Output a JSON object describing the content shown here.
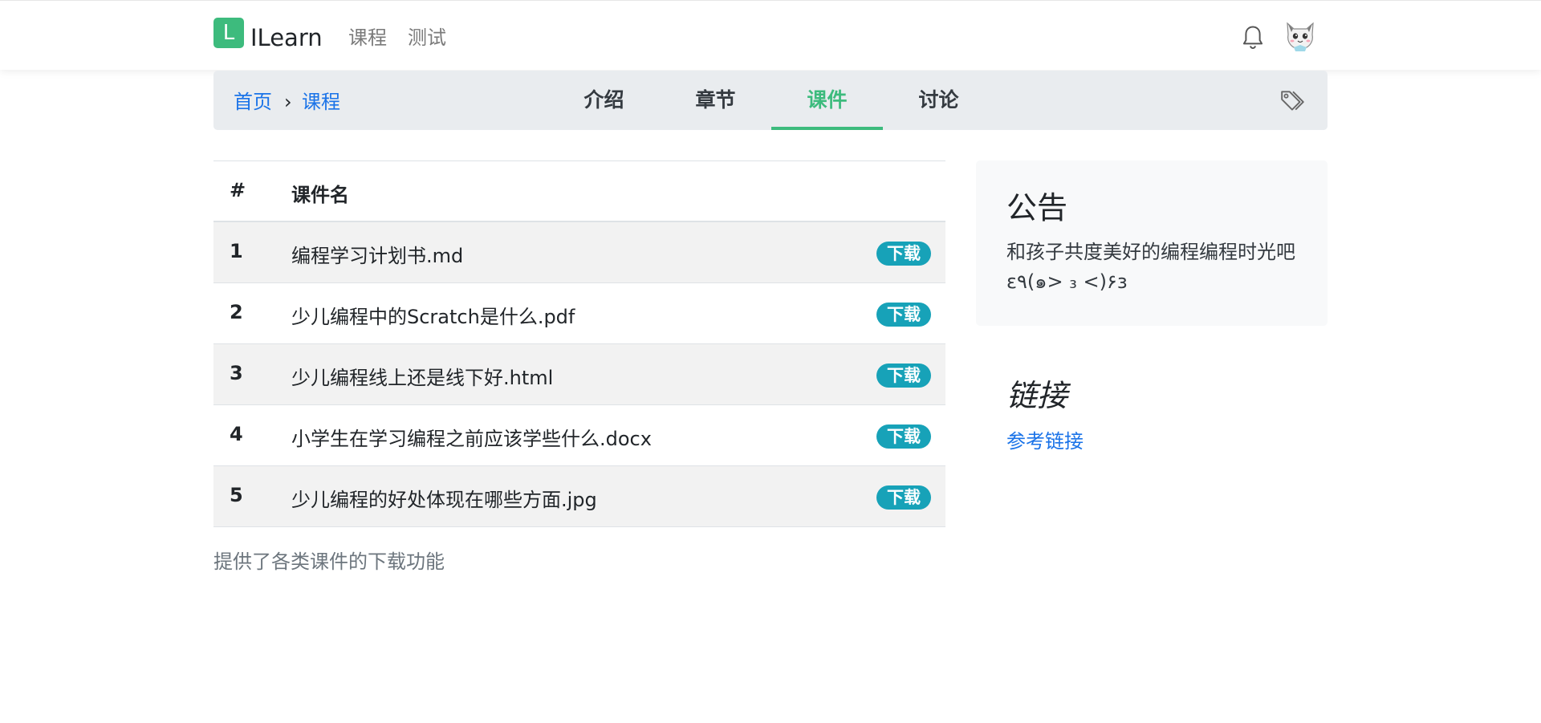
{
  "navbar": {
    "logo_letter": "L",
    "brand": "ILearn",
    "links": [
      "课程",
      "测试"
    ]
  },
  "subnav": {
    "breadcrumb": [
      "首页",
      "课程"
    ],
    "breadcrumb_sep": "›",
    "tabs": [
      "介绍",
      "章节",
      "课件",
      "讨论"
    ],
    "active_tab": "课件"
  },
  "table": {
    "headers": [
      "#",
      "课件名"
    ],
    "rows": [
      {
        "num": "1",
        "name": "编程学习计划书.md",
        "action": "下载"
      },
      {
        "num": "2",
        "name": "少儿编程中的Scratch是什么.pdf",
        "action": "下载"
      },
      {
        "num": "3",
        "name": "少儿编程线上还是线下好.html",
        "action": "下载"
      },
      {
        "num": "4",
        "name": "小学生在学习编程之前应该学些什么.docx",
        "action": "下载"
      },
      {
        "num": "5",
        "name": "少儿编程的好处体现在哪些方面.jpg",
        "action": "下载"
      }
    ],
    "caption": "提供了各类课件的下载功能"
  },
  "sidebar": {
    "notice_title": "公告",
    "notice_text": "和孩子共度美好的编程编程时光吧ε٩(๑> ₃ <)۶з",
    "links_title": "链接",
    "ref_link": "参考链接"
  },
  "colors": {
    "accent": "#3dbb7d",
    "link": "#1a73e8",
    "badge": "#17a2b8"
  },
  "icons": [
    "bell-icon",
    "avatar",
    "tag-icon"
  ]
}
